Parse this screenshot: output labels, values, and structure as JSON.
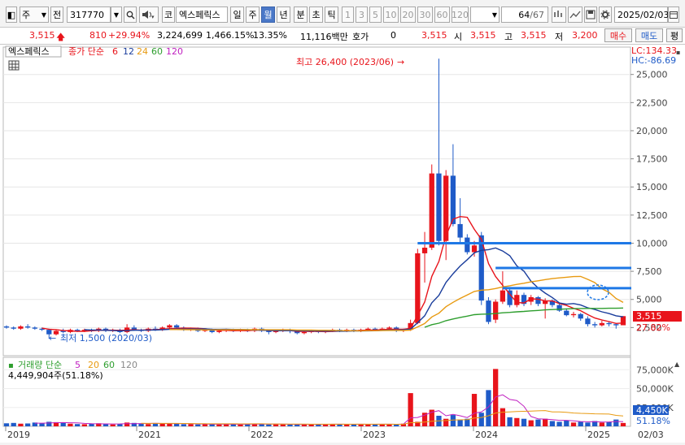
{
  "toolbar": {
    "type_label": "주",
    "jeon_label": "전",
    "code": "317770",
    "kor_label": "코",
    "stock_name": "엑스페릭스",
    "periods": [
      "일",
      "주",
      "월",
      "년"
    ],
    "intraday": [
      "분",
      "초",
      "틱"
    ],
    "numbers": [
      "1",
      "3",
      "5",
      "10",
      "20",
      "30",
      "60",
      "120"
    ],
    "page_current": "64",
    "page_total": "/67",
    "date": "2025/02/03"
  },
  "quote": {
    "price": "3,515",
    "change": "810",
    "change_pct": "+29.94%",
    "volume": "3,224,699",
    "volume_pct": "1,466.15%",
    "turnover_pct": "13.35%",
    "amount": "11,116백만",
    "hoga_label": "호가",
    "hoga_value": "0",
    "last": "3,515",
    "open_label": "시",
    "open": "3,515",
    "high_label": "고",
    "high": "3,515",
    "low_label": "저",
    "low": "3,200",
    "buy_label": "매수",
    "sell_label": "매도",
    "eval_label": "평"
  },
  "chart": {
    "stock_tag": "엑스페릭스",
    "ma_title": "종가 단순",
    "ma_periods": [
      {
        "label": "6",
        "color": "#e8141b"
      },
      {
        "label": "12",
        "color": "#1a3d9c"
      },
      {
        "label": "24",
        "color": "#e89a10"
      },
      {
        "label": "60",
        "color": "#2e9e2e"
      },
      {
        "label": "120",
        "color": "#c020c0"
      }
    ],
    "lc_label": "LC:134.33",
    "hc_label": "HC:-86.69",
    "high_annotation": "최고 26,400 (2023/06)",
    "low_annotation": "최저 1,500 (2020/03)",
    "price_axis": [
      "25,000",
      "22,500",
      "20,000",
      "17,500",
      "15,000",
      "12,500",
      "10,000",
      "7,500",
      "5,000",
      "2,500"
    ],
    "current_price_tag": "3,515",
    "current_pct_tag": "27.82%",
    "volume_title": "거래량 단순",
    "volume_mas": [
      {
        "label": "5",
        "color": "#c020c0"
      },
      {
        "label": "20",
        "color": "#e89a10"
      },
      {
        "label": "60",
        "color": "#2e9e2e"
      },
      {
        "label": "120",
        "color": "#888888"
      }
    ],
    "volume_value": "4,449,904주(51.18%)",
    "volume_axis": [
      "75,000K",
      "50,000K",
      "25,000K"
    ],
    "volume_tag": "4,450K",
    "volume_pct_tag": "51.18%",
    "x_axis": [
      "2019",
      "2021",
      "2022",
      "2023",
      "2024",
      "2025",
      "02/03"
    ]
  },
  "colors": {
    "up": "#e8141b",
    "down": "#1f5bc8",
    "trend": "#1e78e6",
    "ma6": "#e8141b",
    "ma12": "#1a3d9c",
    "ma24": "#e89a10",
    "ma60": "#2e9e2e",
    "ma120": "#c020c0"
  },
  "chart_data": {
    "type": "candlestick",
    "ylim": [
      0,
      27000
    ],
    "yticks": [
      2500,
      5000,
      7500,
      10000,
      12500,
      15000,
      17500,
      20000,
      22500,
      25000
    ],
    "x_labels": [
      "2019",
      "2021",
      "2022",
      "2023",
      "2024",
      "2025"
    ],
    "candles": [
      {
        "o": 2600,
        "c": 2500,
        "h": 2700,
        "l": 2400
      },
      {
        "o": 2500,
        "c": 2400,
        "h": 2600,
        "l": 2300
      },
      {
        "o": 2400,
        "c": 2600,
        "h": 2700,
        "l": 2300
      },
      {
        "o": 2600,
        "c": 2500,
        "h": 2800,
        "l": 2400
      },
      {
        "o": 2500,
        "c": 2400,
        "h": 2600,
        "l": 2300
      },
      {
        "o": 2400,
        "c": 2300,
        "h": 2500,
        "l": 2200
      },
      {
        "o": 2300,
        "c": 1900,
        "h": 2400,
        "l": 1500
      },
      {
        "o": 1900,
        "c": 2200,
        "h": 2300,
        "l": 1800
      },
      {
        "o": 2200,
        "c": 2100,
        "h": 2400,
        "l": 2000
      },
      {
        "o": 2100,
        "c": 2300,
        "h": 2400,
        "l": 2000
      },
      {
        "o": 2300,
        "c": 2200,
        "h": 2400,
        "l": 2100
      },
      {
        "o": 2200,
        "c": 2300,
        "h": 2400,
        "l": 2100
      },
      {
        "o": 2300,
        "c": 2200,
        "h": 2400,
        "l": 2100
      },
      {
        "o": 2200,
        "c": 2400,
        "h": 2500,
        "l": 2100
      },
      {
        "o": 2400,
        "c": 2200,
        "h": 2500,
        "l": 2100
      },
      {
        "o": 2200,
        "c": 2300,
        "h": 2400,
        "l": 2100
      },
      {
        "o": 2300,
        "c": 2100,
        "h": 2400,
        "l": 2000
      },
      {
        "o": 2100,
        "c": 2500,
        "h": 2800,
        "l": 2000
      },
      {
        "o": 2500,
        "c": 2300,
        "h": 2700,
        "l": 2200
      },
      {
        "o": 2300,
        "c": 2200,
        "h": 2400,
        "l": 2100
      },
      {
        "o": 2200,
        "c": 2400,
        "h": 2500,
        "l": 2100
      },
      {
        "o": 2400,
        "c": 2300,
        "h": 2600,
        "l": 2200
      },
      {
        "o": 2300,
        "c": 2500,
        "h": 2600,
        "l": 2200
      },
      {
        "o": 2500,
        "c": 2700,
        "h": 2800,
        "l": 2400
      },
      {
        "o": 2700,
        "c": 2500,
        "h": 2800,
        "l": 2400
      },
      {
        "o": 2500,
        "c": 2300,
        "h": 2600,
        "l": 2200
      },
      {
        "o": 2300,
        "c": 2400,
        "h": 2500,
        "l": 2200
      },
      {
        "o": 2400,
        "c": 2200,
        "h": 2500,
        "l": 2100
      },
      {
        "o": 2200,
        "c": 2300,
        "h": 2400,
        "l": 2100
      },
      {
        "o": 2300,
        "c": 2100,
        "h": 2400,
        "l": 2000
      },
      {
        "o": 2100,
        "c": 2200,
        "h": 2300,
        "l": 2000
      },
      {
        "o": 2200,
        "c": 2300,
        "h": 2400,
        "l": 2100
      },
      {
        "o": 2300,
        "c": 2200,
        "h": 2400,
        "l": 2100
      },
      {
        "o": 2200,
        "c": 2300,
        "h": 2400,
        "l": 2100
      },
      {
        "o": 2300,
        "c": 2200,
        "h": 2400,
        "l": 2100
      },
      {
        "o": 2200,
        "c": 2400,
        "h": 2500,
        "l": 2100
      },
      {
        "o": 2400,
        "c": 2200,
        "h": 2500,
        "l": 2100
      },
      {
        "o": 2200,
        "c": 2100,
        "h": 2300,
        "l": 1900
      },
      {
        "o": 2100,
        "c": 2200,
        "h": 2300,
        "l": 2000
      },
      {
        "o": 2200,
        "c": 2300,
        "h": 2400,
        "l": 2100
      },
      {
        "o": 2300,
        "c": 2200,
        "h": 2400,
        "l": 2000
      },
      {
        "o": 2200,
        "c": 2000,
        "h": 2300,
        "l": 1900
      },
      {
        "o": 2000,
        "c": 2100,
        "h": 2200,
        "l": 1900
      },
      {
        "o": 2100,
        "c": 2200,
        "h": 2300,
        "l": 2000
      },
      {
        "o": 2200,
        "c": 2100,
        "h": 2300,
        "l": 2000
      },
      {
        "o": 2100,
        "c": 2200,
        "h": 2300,
        "l": 2000
      },
      {
        "o": 2200,
        "c": 2300,
        "h": 2400,
        "l": 2100
      },
      {
        "o": 2300,
        "c": 2200,
        "h": 2400,
        "l": 2100
      },
      {
        "o": 2200,
        "c": 2300,
        "h": 2400,
        "l": 2100
      },
      {
        "o": 2300,
        "c": 2200,
        "h": 2400,
        "l": 2100
      },
      {
        "o": 2200,
        "c": 2300,
        "h": 2400,
        "l": 2100
      },
      {
        "o": 2300,
        "c": 2400,
        "h": 2500,
        "l": 2200
      },
      {
        "o": 2400,
        "c": 2300,
        "h": 2500,
        "l": 2200
      },
      {
        "o": 2300,
        "c": 2400,
        "h": 2500,
        "l": 2200
      },
      {
        "o": 2400,
        "c": 2500,
        "h": 2600,
        "l": 2300
      },
      {
        "o": 2500,
        "c": 2200,
        "h": 2600,
        "l": 2100
      },
      {
        "o": 2200,
        "c": 2300,
        "h": 2400,
        "l": 2100
      },
      {
        "o": 2300,
        "c": 2900,
        "h": 3200,
        "l": 2200
      },
      {
        "o": 2900,
        "c": 9100,
        "h": 9500,
        "l": 2800
      },
      {
        "o": 9100,
        "c": 9600,
        "h": 11000,
        "l": 6500
      },
      {
        "o": 9600,
        "c": 16200,
        "h": 17000,
        "l": 9400
      },
      {
        "o": 16200,
        "c": 10200,
        "h": 26400,
        "l": 9800
      },
      {
        "o": 10200,
        "c": 16000,
        "h": 16500,
        "l": 8500
      },
      {
        "o": 16000,
        "c": 11700,
        "h": 18800,
        "l": 11500
      },
      {
        "o": 11700,
        "c": 10500,
        "h": 14000,
        "l": 10000
      },
      {
        "o": 10500,
        "c": 9200,
        "h": 10800,
        "l": 9000
      },
      {
        "o": 9200,
        "c": 9800,
        "h": 10200,
        "l": 8800
      },
      {
        "o": 10700,
        "c": 4900,
        "h": 11000,
        "l": 4500
      },
      {
        "o": 4900,
        "c": 3000,
        "h": 5200,
        "l": 2800
      },
      {
        "o": 3200,
        "c": 4800,
        "h": 5000,
        "l": 2900
      },
      {
        "o": 4800,
        "c": 5800,
        "h": 7500,
        "l": 4600
      },
      {
        "o": 5800,
        "c": 4500,
        "h": 6000,
        "l": 4300
      },
      {
        "o": 4500,
        "c": 5400,
        "h": 5800,
        "l": 4300
      },
      {
        "o": 5400,
        "c": 4600,
        "h": 5600,
        "l": 4400
      },
      {
        "o": 4800,
        "c": 5200,
        "h": 5400,
        "l": 4500
      },
      {
        "o": 5200,
        "c": 4600,
        "h": 5300,
        "l": 4400
      },
      {
        "o": 4600,
        "c": 4900,
        "h": 5100,
        "l": 3300
      },
      {
        "o": 4900,
        "c": 4500,
        "h": 5000,
        "l": 4300
      },
      {
        "o": 4500,
        "c": 4000,
        "h": 4700,
        "l": 3900
      },
      {
        "o": 4000,
        "c": 3600,
        "h": 4200,
        "l": 3500
      },
      {
        "o": 3600,
        "c": 3700,
        "h": 3900,
        "l": 3400
      },
      {
        "o": 3700,
        "c": 3300,
        "h": 3800,
        "l": 3100
      },
      {
        "o": 3300,
        "c": 2800,
        "h": 3500,
        "l": 2600
      },
      {
        "o": 2800,
        "c": 2700,
        "h": 3000,
        "l": 2500
      },
      {
        "o": 2700,
        "c": 2900,
        "h": 3100,
        "l": 2600
      },
      {
        "o": 2900,
        "c": 2800,
        "h": 3000,
        "l": 2600
      },
      {
        "o": 2800,
        "c": 2700,
        "h": 2900,
        "l": 2400
      },
      {
        "o": 2705,
        "c": 3515,
        "h": 3515,
        "l": 3200
      }
    ],
    "volumes_k": [
      4000,
      4500,
      3500,
      3800,
      5000,
      4000,
      6000,
      5500,
      4500,
      3500,
      3000,
      2800,
      3500,
      4000,
      3000,
      2500,
      3000,
      5000,
      4500,
      3500,
      3000,
      3800,
      4000,
      4200,
      3500,
      2800,
      3000,
      2500,
      3000,
      2800,
      2500,
      3000,
      2800,
      2500,
      3000,
      3500,
      2800,
      2500,
      2800,
      3000,
      2500,
      2200,
      2500,
      3000,
      2800,
      2500,
      3000,
      2800,
      2500,
      2800,
      3000,
      2500,
      2800,
      3000,
      2500,
      2800,
      3500,
      44000,
      6000,
      18000,
      22000,
      14000,
      10000,
      15000,
      9000,
      10000,
      43000,
      18000,
      48000,
      76000,
      24000,
      12000,
      11000,
      10000,
      8000,
      9000,
      10000,
      7000,
      6000,
      8000,
      5000,
      6000,
      5000,
      7000,
      5000,
      6000,
      9000,
      4450
    ],
    "trendlines": [
      {
        "price": 10000,
        "from_index": 58
      },
      {
        "price": 7800,
        "from_index": 69
      },
      {
        "price": 6000,
        "from_index": 70
      }
    ]
  }
}
